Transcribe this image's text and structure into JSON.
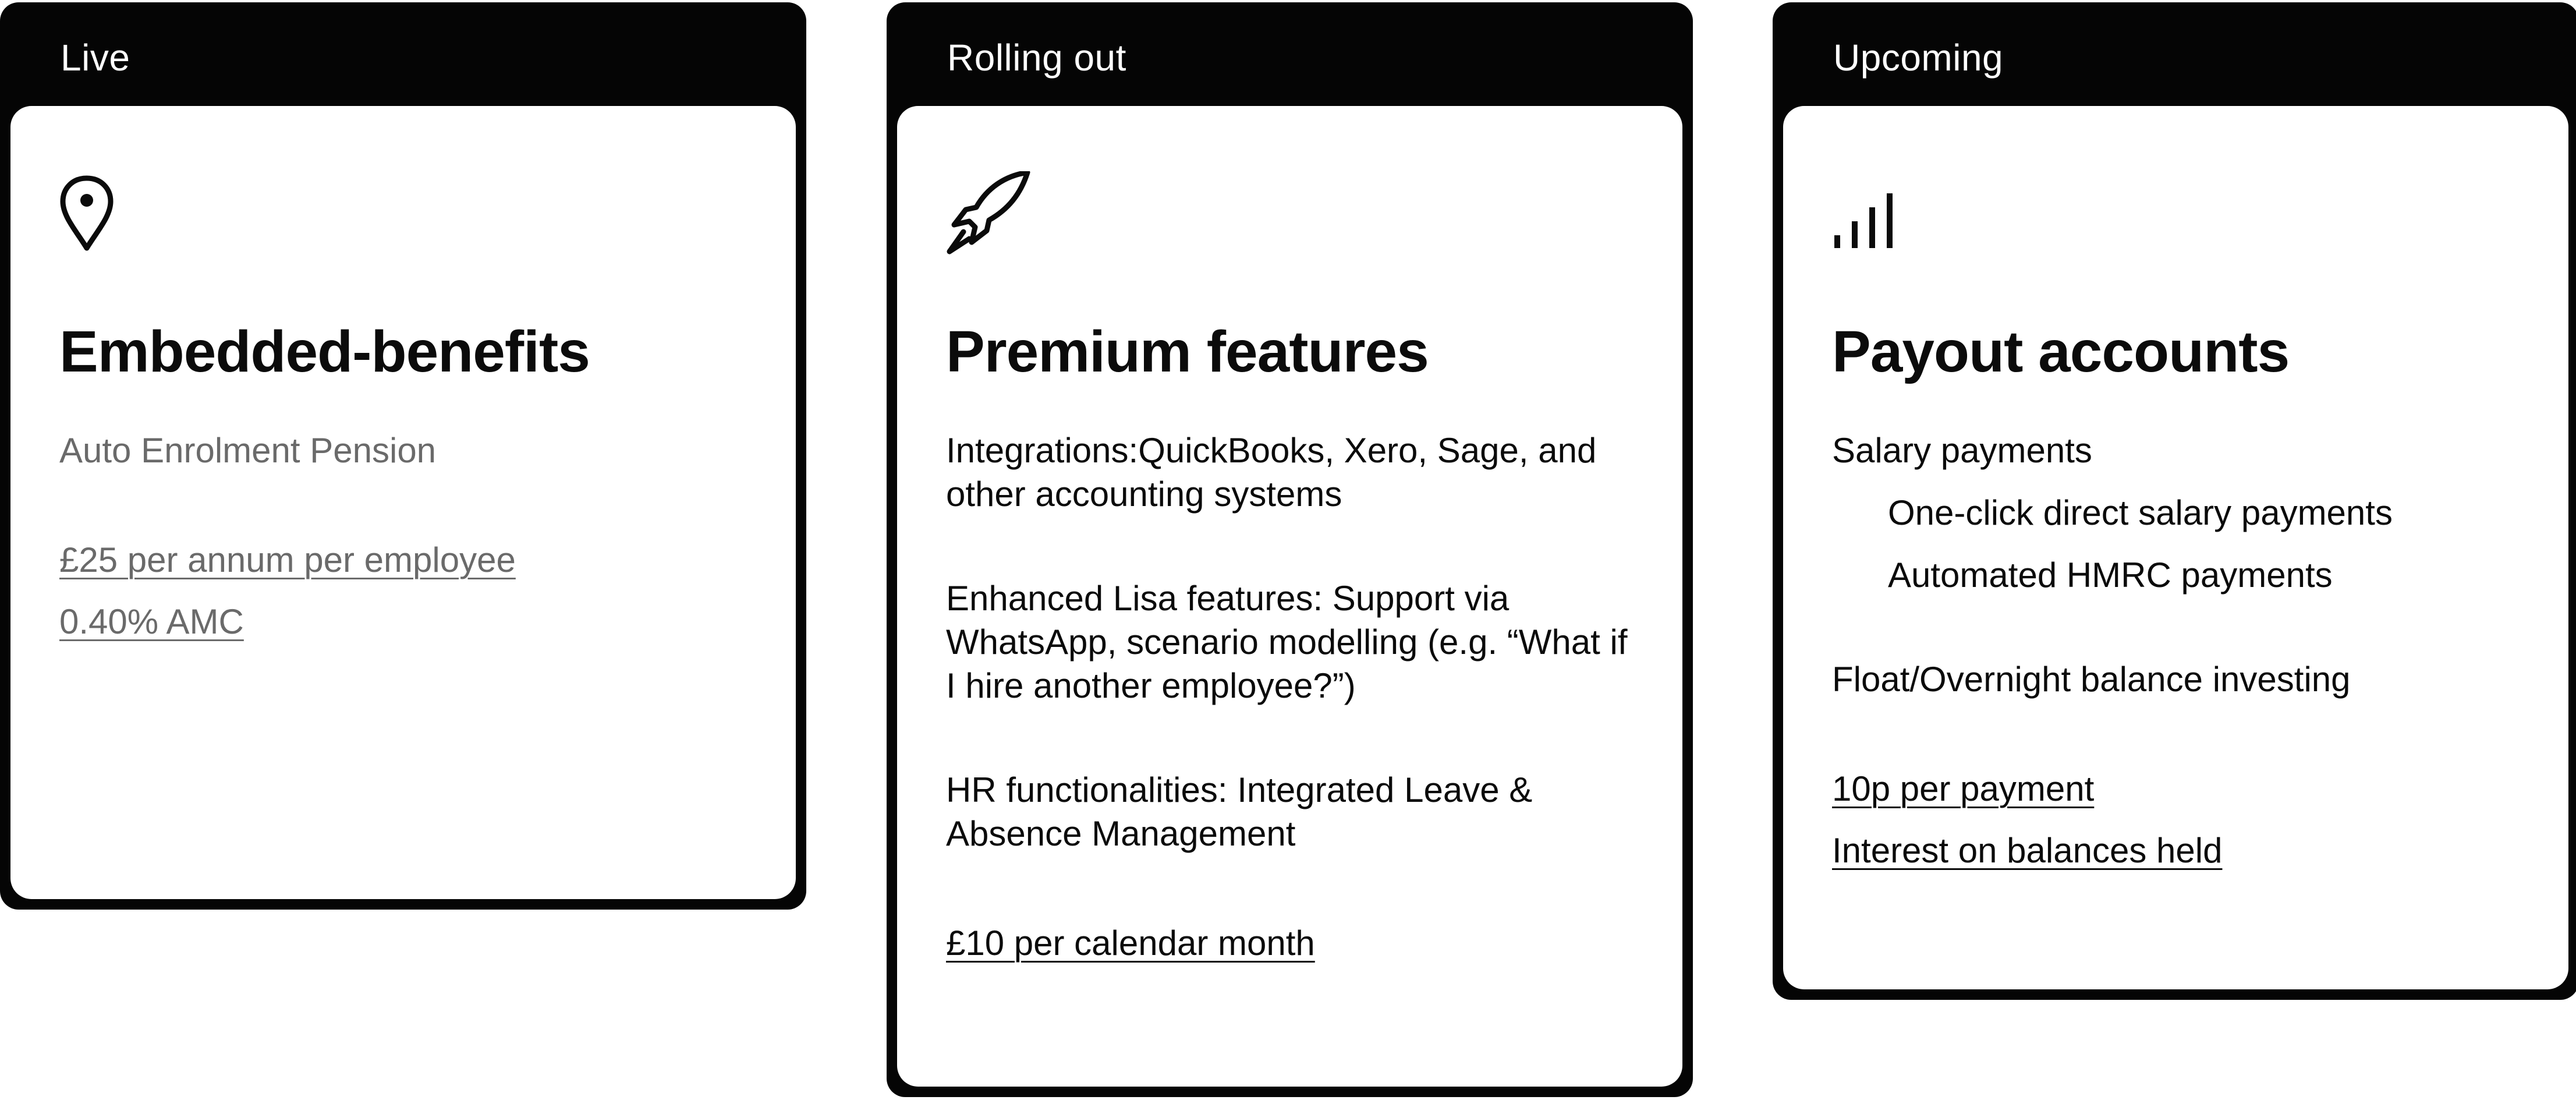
{
  "cards": [
    {
      "status": "Live",
      "icon": "map-pin-icon",
      "title": "Embedded-benefits",
      "subtitle": "Auto Enrolment Pension",
      "pricing": [
        "£25 per annum per employee",
        "0.40% AMC"
      ]
    },
    {
      "status": "Rolling out",
      "icon": "rocket-icon",
      "title": "Premium features",
      "features": [
        "Integrations:QuickBooks, Xero, Sage, and other accounting systems",
        "Enhanced Lisa features: Support via WhatsApp, scenario modelling (e.g. “What if I hire another employee?”)",
        "HR functionalities: Integrated Leave & Absence Management"
      ],
      "pricing": [
        "£10 per calendar month"
      ]
    },
    {
      "status": "Upcoming",
      "icon": "signal-bars-icon",
      "title": "Payout accounts",
      "section_label": "Salary payments",
      "sub_items": [
        "One-click direct salary payments",
        "Automated HMRC payments"
      ],
      "extra": "Float/Overnight balance investing",
      "pricing": [
        "10p per payment",
        "Interest on balances held"
      ]
    }
  ]
}
